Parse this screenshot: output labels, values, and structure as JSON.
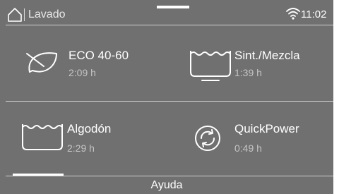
{
  "status_bar": {
    "title": "Lavado",
    "time": "11:02",
    "icons": [
      "home-icon",
      "wifi-icon"
    ]
  },
  "programs": [
    {
      "name": "ECO 40-60",
      "duration": "2:09 h",
      "icon": "leaf-icon"
    },
    {
      "name": "Sint./Mezcla",
      "duration": "1:39  h",
      "icon": "basin-synthetic-icon"
    },
    {
      "name": "Algodón",
      "duration": "2:29  h",
      "icon": "basin-cotton-icon"
    },
    {
      "name": "QuickPower",
      "duration": "0:49 h",
      "icon": "quickpower-icon"
    }
  ],
  "footer": {
    "help_label": "Ayuda"
  },
  "colors": {
    "background": "#707070",
    "text": "#ffffff",
    "secondary_text": "#c4c4c4",
    "divider": "#d0d0d0"
  }
}
